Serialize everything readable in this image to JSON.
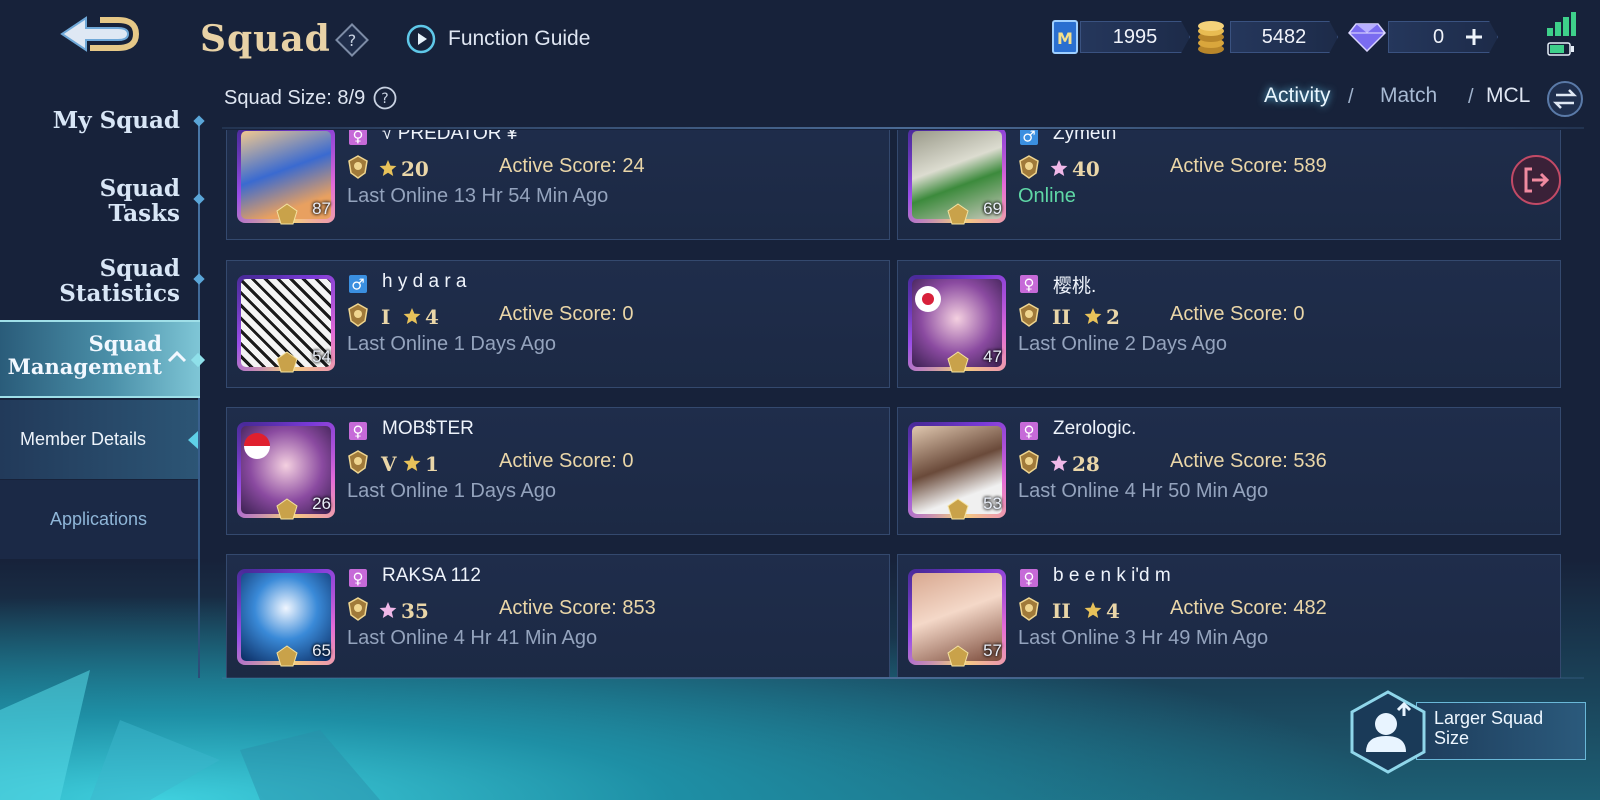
{
  "header": {
    "title": "Squad",
    "function_guide": "Function Guide",
    "currencies": [
      {
        "icon": "mcl-ticket-icon",
        "value": "1995"
      },
      {
        "icon": "gold-coins-icon",
        "value": "5482"
      },
      {
        "icon": "diamond-icon",
        "value": "0"
      }
    ]
  },
  "sidebar": {
    "items": [
      {
        "label_line1": "My Squad",
        "label_line2": ""
      },
      {
        "label_line1": "Squad",
        "label_line2": "Tasks"
      },
      {
        "label_line1": "Squad",
        "label_line2": "Statistics"
      },
      {
        "label_line1": "Squad",
        "label_line2": "Management"
      }
    ],
    "sub_items": [
      "Member Details",
      "Applications"
    ]
  },
  "squad_size": "Squad Size: 8/9",
  "tabs": {
    "activity": "Activity",
    "match": "Match",
    "mcl": "MCL",
    "separator": "/"
  },
  "members": [
    {
      "name": "√ PREDATOR ¥",
      "gender": "female",
      "tier": "",
      "stars": "20",
      "star_color": "gold",
      "active_score": "Active Score: 24",
      "status": "Last Online 13 Hr 54 Min Ago",
      "online": false,
      "level": "87"
    },
    {
      "name": "Zymeth",
      "gender": "male",
      "tier": "",
      "stars": "40",
      "star_color": "pink",
      "active_score": "Active Score: 589",
      "status": "Online",
      "online": true,
      "level": "69"
    },
    {
      "name": "h y d a r a",
      "gender": "male",
      "tier": "I",
      "stars": "4",
      "star_color": "gold",
      "active_score": "Active Score: 0",
      "status": "Last Online 1 Days Ago",
      "online": false,
      "level": "54"
    },
    {
      "name": "樱桃.",
      "gender": "female",
      "tier": "II",
      "stars": "2",
      "star_color": "gold",
      "active_score": "Active Score: 0",
      "status": "Last Online 2 Days Ago",
      "online": false,
      "level": "47"
    },
    {
      "name": "MOB$TER",
      "gender": "female",
      "tier": "V",
      "stars": "1",
      "star_color": "gold",
      "active_score": "Active Score: 0",
      "status": "Last Online 1 Days Ago",
      "online": false,
      "level": "26"
    },
    {
      "name": "Zerologic.",
      "gender": "female",
      "tier": "",
      "stars": "28",
      "star_color": "pink",
      "active_score": "Active Score: 536",
      "status": "Last Online 4 Hr 50 Min Ago",
      "online": false,
      "level": "53"
    },
    {
      "name": "RAKSA 112",
      "gender": "female",
      "tier": "",
      "stars": "35",
      "star_color": "pink",
      "active_score": "Active Score: 853",
      "status": "Last Online 4 Hr 41 Min Ago",
      "online": false,
      "level": "65"
    },
    {
      "name": "b e e n k i'd m",
      "gender": "female",
      "tier": "II",
      "stars": "4",
      "star_color": "gold",
      "active_score": "Active Score: 482",
      "status": "Last Online 3 Hr 49 Min Ago",
      "online": false,
      "level": "57"
    }
  ],
  "larger_squad": {
    "line1": "Larger Squad",
    "line2": "Size"
  },
  "colors": {
    "female": "#c66ad8",
    "male": "#3a8fe0",
    "accent_gold": "#ead6a8",
    "online_green": "#5fd8a6"
  }
}
